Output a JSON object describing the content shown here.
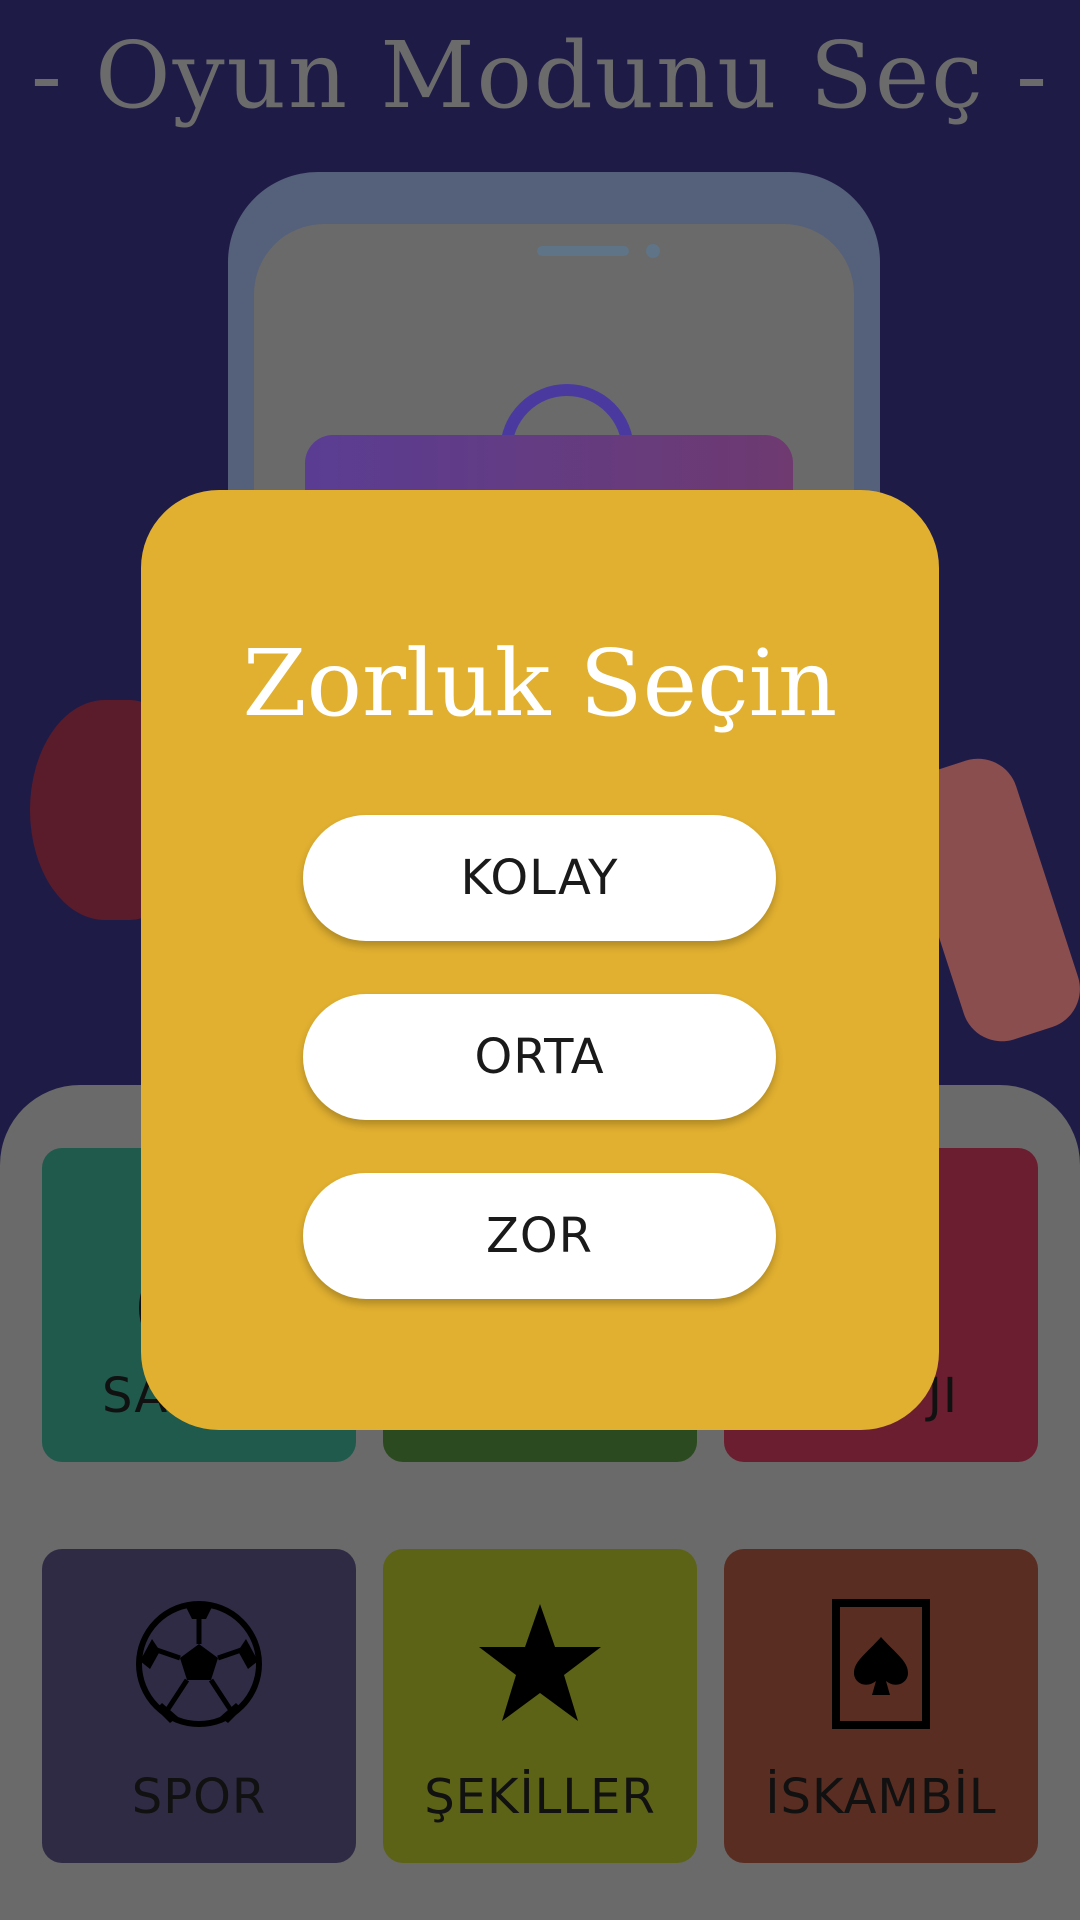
{
  "header": {
    "title": "- Oyun Modunu Seç -"
  },
  "tiles": [
    {
      "label": "SA",
      "color": "#1f5a4c",
      "icon": "circle-icon"
    },
    {
      "label": "",
      "color": "#2b4a1f",
      "icon": ""
    },
    {
      "label": "JI",
      "color": "#6a1e30",
      "icon": "circle-icon"
    },
    {
      "label": "SPOR",
      "color": "#302b45",
      "icon": "soccer-ball-icon"
    },
    {
      "label": "ŞEKİLLER",
      "color": "#5c6316",
      "icon": "star-icon"
    },
    {
      "label": "İSKAMBİL",
      "color": "#5a2d22",
      "icon": "spade-card-icon"
    }
  ],
  "modal": {
    "title": "Zorluk Seçin",
    "easy_label": "KOLAY",
    "medium_label": "ORTA",
    "hard_label": "ZOR",
    "color": "#e1b030"
  }
}
